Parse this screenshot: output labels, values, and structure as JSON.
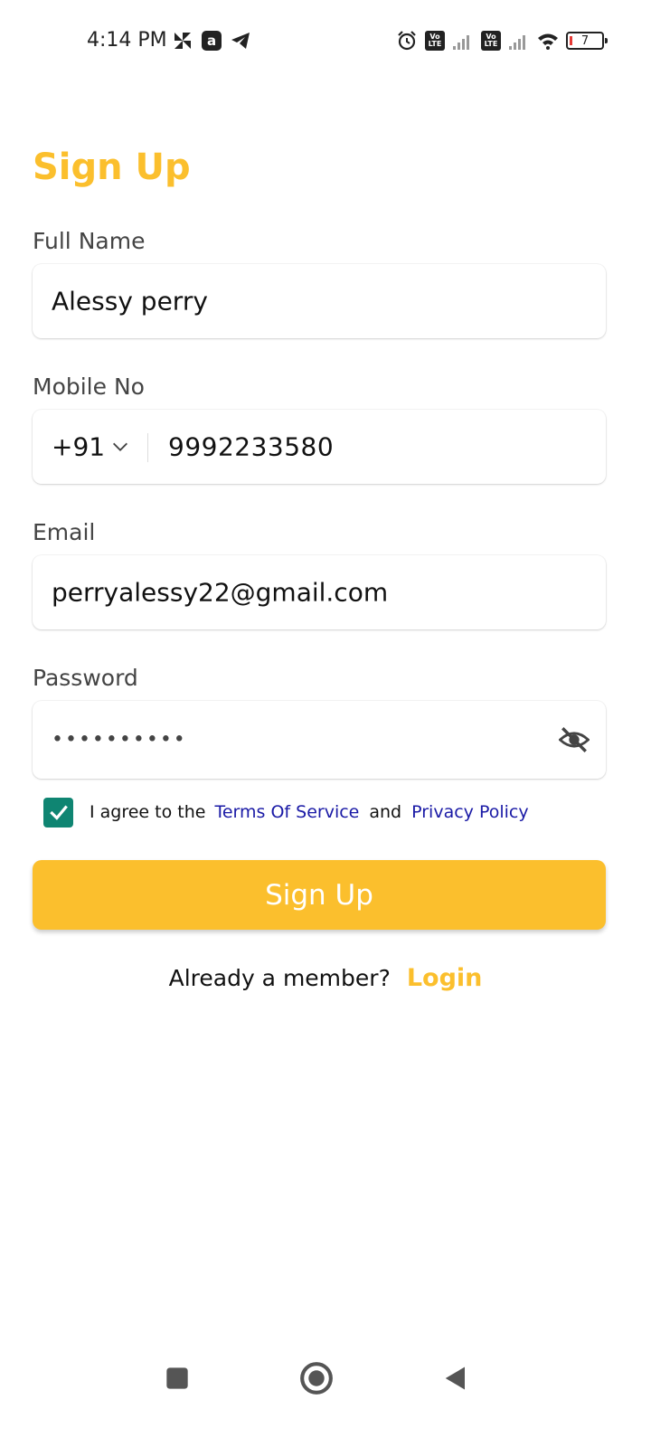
{
  "status_bar": {
    "time": "4:14 PM",
    "left_icons": [
      "pinwheel-icon",
      "a-app-icon",
      "telegram-icon"
    ],
    "right_icons": [
      "alarm-icon",
      "volte-icon",
      "signal-icon",
      "volte-icon",
      "signal-icon",
      "wifi-icon",
      "battery-icon"
    ],
    "volte_line1": "Vo",
    "volte_line2": "LTE",
    "battery_level": "7"
  },
  "page": {
    "title": "Sign Up",
    "accent_color": "#fbbf2d"
  },
  "form": {
    "full_name": {
      "label": "Full Name",
      "value": "Alessy perry"
    },
    "mobile": {
      "label": "Mobile No",
      "country_code": "+91",
      "value": "9992233580"
    },
    "email": {
      "label": "Email",
      "value": "perryalessy22@gmail.com"
    },
    "password": {
      "label": "Password",
      "value_masked": "••••••••••",
      "toggle_icon": "eye-off-icon"
    }
  },
  "terms": {
    "checked": true,
    "prefix": "I agree to the",
    "terms_link": "Terms Of Service",
    "conjunction": "and",
    "privacy_link": "Privacy Policy"
  },
  "actions": {
    "signup_label": "Sign Up",
    "member_prompt": "Already a member?",
    "login_label": "Login"
  },
  "nav_bar": {
    "buttons": [
      "recents-icon",
      "home-icon",
      "back-icon"
    ]
  }
}
